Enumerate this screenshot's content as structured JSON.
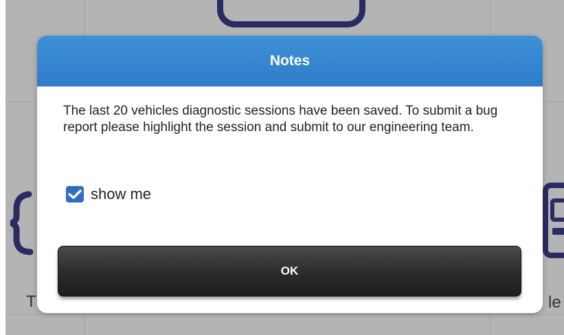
{
  "dialog": {
    "title": "Notes",
    "message": "The last 20 vehicles diagnostic sessions have been saved. To submit a bug report please highlight the session and submit to our engineering team.",
    "checkbox": {
      "label": "show me",
      "checked": true
    },
    "ok_label": "OK",
    "header_color": "#3784cf"
  },
  "background": {
    "left_text": "T",
    "right_text": "le",
    "icon_color": "#2a2b63"
  }
}
